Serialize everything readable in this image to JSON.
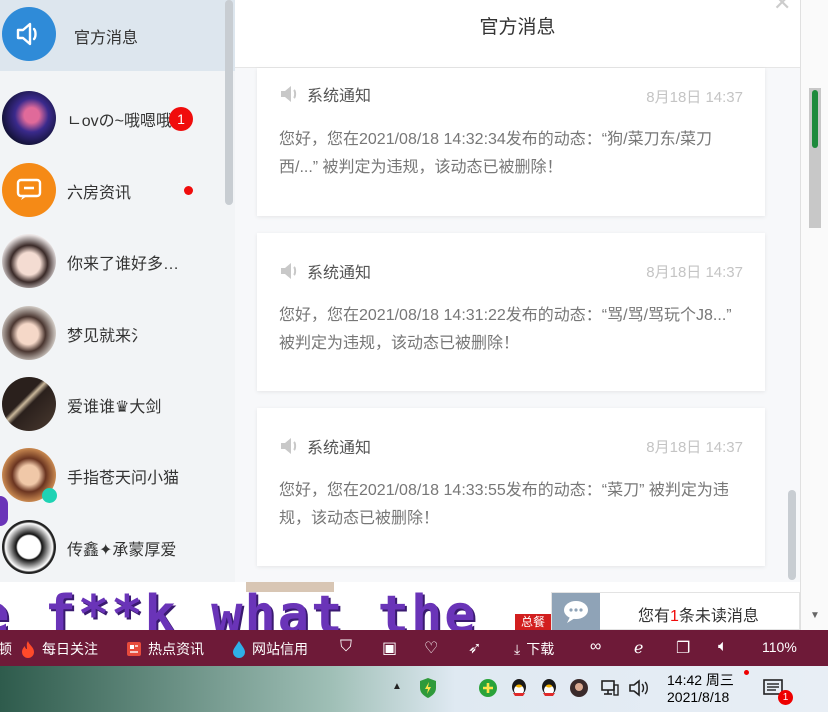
{
  "sidebar": {
    "conversations": [
      {
        "name": "官方消息",
        "active": true
      },
      {
        "name": "ㄴovの~哦嗯哦",
        "badge": "1"
      },
      {
        "name": "六房资讯",
        "dot": true
      },
      {
        "name": "你来了谁好多…"
      },
      {
        "name": "梦见就来氵"
      },
      {
        "name": "爱谁谁♛大剑"
      },
      {
        "name": "手指苍天问小猫"
      },
      {
        "name": "传鑫✦承蒙厚爱"
      }
    ]
  },
  "main": {
    "title": "官方消息",
    "messages": [
      {
        "label": "系统通知",
        "time": "8月18日 14:37",
        "text": "您好，您在2021/08/18 14:32:34发布的动态：“狗/菜刀东/菜刀西/...” 被判定为违规，该动态已被删除！"
      },
      {
        "label": "系统通知",
        "time": "8月18日 14:37",
        "text": "您好，您在2021/08/18 14:31:22发布的动态：“骂/骂/骂玩个J8...” 被判定为违规，该动态已被删除！"
      },
      {
        "label": "系统通知",
        "time": "8月18日 14:37",
        "text": "您好，您在2021/08/18 14:33:55发布的动态：“菜刀” 被判定为违规，该动态已被删除！"
      }
    ]
  },
  "overlay": {
    "text": "e f**k what the"
  },
  "behind": {
    "tag": "总餐"
  },
  "unread": {
    "prefix": "您有",
    "count": "1",
    "suffix": "条未读消息"
  },
  "browser_bar": {
    "items": [
      {
        "label": "顿"
      },
      {
        "label": "每日关注",
        "icon": "fire-icon"
      },
      {
        "label": "热点资讯",
        "icon": "news-icon"
      },
      {
        "label": "网站信用",
        "icon": "drop-icon"
      }
    ],
    "download": "下载",
    "zoom": "110%"
  },
  "taskbar": {
    "time": "14:42 周三",
    "date": "2021/8/18",
    "notifications": "1"
  },
  "colors": {
    "accent_red": "#f00c0c",
    "browser_bar": "#6e1a38",
    "overlay_purple": "#6a34b8"
  }
}
